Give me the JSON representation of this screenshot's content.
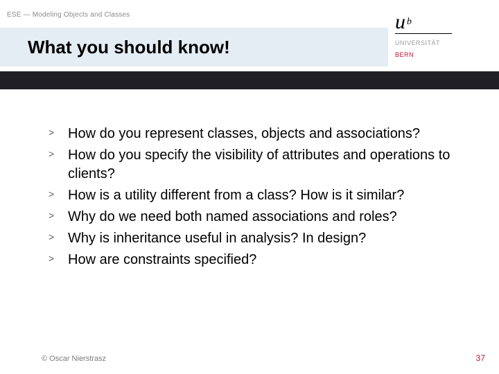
{
  "breadcrumb": "ESE — Modeling Objects and Classes",
  "title": "What you should know!",
  "logo": {
    "u": "u",
    "b": "b",
    "uni_gray": "UNIVERSITÄT",
    "uni_red": "BERN"
  },
  "bullets": [
    "How do you represent classes, objects and associations?",
    "How do you specify the visibility of attributes and operations to clients?",
    "How is a utility different from a class? How is it similar?",
    "Why do we need both named associations and roles?",
    "Why is inheritance useful in analysis? In design?",
    "How are constraints specified?"
  ],
  "footer": {
    "copyright": "© Oscar Nierstrasz",
    "page": "37"
  }
}
